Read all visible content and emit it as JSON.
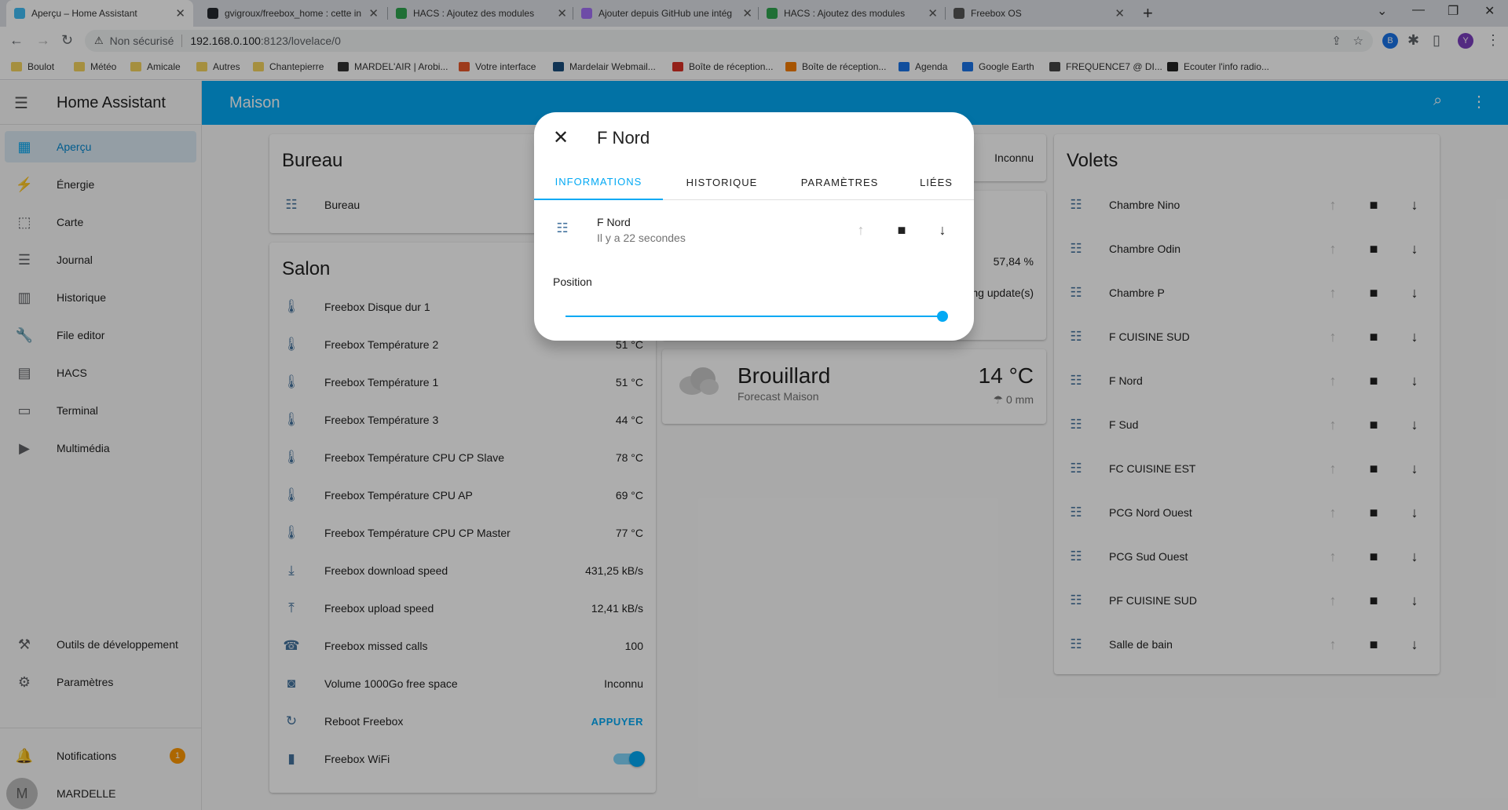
{
  "browser": {
    "tabs": [
      {
        "title": "Aperçu – Home Assistant",
        "active": true,
        "color": "#41bdf5"
      },
      {
        "title": "gvigroux/freebox_home : cette in",
        "active": false,
        "color": "#24292f"
      },
      {
        "title": "HACS : Ajoutez des modules",
        "active": false,
        "color": "#2ea44f"
      },
      {
        "title": "Ajouter depuis GitHub une intég",
        "active": false,
        "color": "#a371f7"
      },
      {
        "title": "HACS : Ajoutez des modules",
        "active": false,
        "color": "#2ea44f"
      },
      {
        "title": "Freebox OS",
        "active": false,
        "color": "#555555"
      }
    ],
    "security_label": "Non sécurisé",
    "url_host": "192.168.0.100",
    "url_path": ":8123/lovelace/0",
    "profile_initial": "Y",
    "ext_initial": "B",
    "bookmarks": [
      {
        "label": "Boulot",
        "color": "#f4d35e"
      },
      {
        "label": "Météo",
        "color": "#f4d35e"
      },
      {
        "label": "Amicale",
        "color": "#f4d35e"
      },
      {
        "label": "Autres",
        "color": "#f4d35e"
      },
      {
        "label": "Chantepierre",
        "color": "#f4d35e"
      },
      {
        "label": "MARDEL'AIR | Arobi...",
        "color": "#333333"
      },
      {
        "label": "Votre interface",
        "color": "#e8572a"
      },
      {
        "label": "Mardelair Webmail...",
        "color": "#1a4d7c"
      },
      {
        "label": "Boîte de réception...",
        "color": "#d93025"
      },
      {
        "label": "Boîte de réception...",
        "color": "#f57c00"
      },
      {
        "label": "Agenda",
        "color": "#1a73e8"
      },
      {
        "label": "Google Earth",
        "color": "#1a73e8"
      },
      {
        "label": "FREQUENCE7 @ DI...",
        "color": "#444444"
      },
      {
        "label": "Ecouter l'info radio...",
        "color": "#222222"
      }
    ]
  },
  "sidebar": {
    "title": "Home Assistant",
    "items": [
      {
        "label": "Aperçu",
        "icon": "dashboard-icon",
        "glyph": "▦",
        "active": true
      },
      {
        "label": "Énergie",
        "icon": "lightning-icon",
        "glyph": "⚡",
        "active": false
      },
      {
        "label": "Carte",
        "icon": "map-icon",
        "glyph": "⬚",
        "active": false
      },
      {
        "label": "Journal",
        "icon": "list-icon",
        "glyph": "☰",
        "active": false
      },
      {
        "label": "Historique",
        "icon": "chart-icon",
        "glyph": "▥",
        "active": false
      },
      {
        "label": "File editor",
        "icon": "wrench-icon",
        "glyph": "🔧",
        "active": false
      },
      {
        "label": "HACS",
        "icon": "hacs-icon",
        "glyph": "▤",
        "active": false
      },
      {
        "label": "Terminal",
        "icon": "terminal-icon",
        "glyph": "▭",
        "active": false
      },
      {
        "label": "Multimédia",
        "icon": "media-icon",
        "glyph": "▶",
        "active": false
      }
    ],
    "dev_tools": "Outils de développement",
    "settings": "Paramètres",
    "notifications": "Notifications",
    "notifications_count": "1",
    "user_initial": "M",
    "user": "MARDELLE"
  },
  "toolbar": {
    "title": "Maison"
  },
  "bureau": {
    "title": "Bureau",
    "rows": [
      {
        "name": "Bureau",
        "state": ""
      }
    ]
  },
  "salon": {
    "title": "Salon",
    "rows": [
      {
        "name": "Freebox Disque dur 1",
        "state": "",
        "icon": "thermometer-icon"
      },
      {
        "name": "Freebox Température 2",
        "state": "51 °C",
        "icon": "thermometer-icon"
      },
      {
        "name": "Freebox Température 1",
        "state": "51 °C",
        "icon": "thermometer-icon"
      },
      {
        "name": "Freebox Température 3",
        "state": "44 °C",
        "icon": "thermometer-icon"
      },
      {
        "name": "Freebox Température CPU CP Slave",
        "state": "78 °C",
        "icon": "thermometer-icon"
      },
      {
        "name": "Freebox Température CPU AP",
        "state": "69 °C",
        "icon": "thermometer-icon"
      },
      {
        "name": "Freebox Température CPU CP Master",
        "state": "77 °C",
        "icon": "thermometer-icon"
      },
      {
        "name": "Freebox download speed",
        "state": "431,25 kB/s",
        "icon": "download-icon"
      },
      {
        "name": "Freebox upload speed",
        "state": "12,41 kB/s",
        "icon": "upload-icon"
      },
      {
        "name": "Freebox missed calls",
        "state": "100",
        "icon": "phone-missed-icon"
      },
      {
        "name": "Volume 1000Go free space",
        "state": "Inconnu",
        "icon": "harddisk-icon"
      },
      {
        "name": "Reboot Freebox",
        "action": "APPUYER",
        "icon": "restart-icon"
      },
      {
        "name": "Freebox WiFi",
        "toggle": true,
        "icon": "wifi-icon"
      }
    ]
  },
  "middle": {
    "top_state": "Inconnu",
    "percent": "57,84 %",
    "update_text": "ng update(s)"
  },
  "weather": {
    "condition": "Brouillard",
    "forecast": "Forecast Maison",
    "temperature": "14 °C",
    "precipitation": "0 mm"
  },
  "volets": {
    "title": "Volets",
    "rows": [
      "Chambre Nino",
      "Chambre Odin",
      "Chambre P",
      "F CUISINE SUD",
      "F Nord",
      "F Sud",
      "FC CUISINE EST",
      "PCG Nord Ouest",
      "PCG Sud Ouest",
      "PF CUISINE SUD",
      "Salle de bain"
    ]
  },
  "dialog": {
    "title": "F Nord",
    "tabs": [
      "INFORMATIONS",
      "HISTORIQUE",
      "PARAMÈTRES",
      "LIÉES"
    ],
    "entity_name": "F Nord",
    "entity_secondary": "Il y a 22 secondes",
    "position_label": "Position",
    "position_value": 1.0
  }
}
